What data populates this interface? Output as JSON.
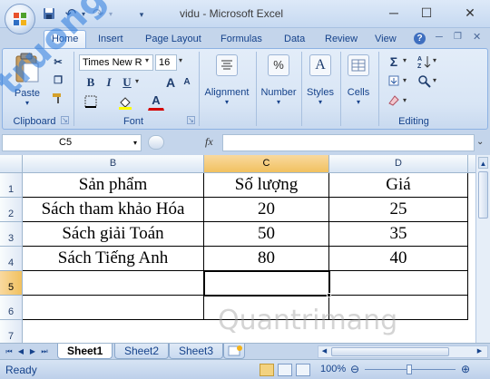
{
  "window": {
    "title": "vidu - Microsoft Excel",
    "minimize_glyph": "─",
    "maximize_glyph": "☐",
    "close_glyph": "✕"
  },
  "quick_access": [
    "save-icon",
    "undo-icon",
    "redo-icon",
    "customize-icon"
  ],
  "tabs": [
    {
      "label": "Home",
      "active": true
    },
    {
      "label": "Insert"
    },
    {
      "label": "Page Layout"
    },
    {
      "label": "Formulas"
    },
    {
      "label": "Data"
    },
    {
      "label": "Review"
    },
    {
      "label": "View"
    }
  ],
  "ribbon": {
    "clipboard": {
      "paste_label": "Paste",
      "group_label": "Clipboard"
    },
    "font": {
      "family": "Times New R",
      "size": "16",
      "bold": "B",
      "italic": "I",
      "underline": "U",
      "group_label": "Font",
      "grow": "A",
      "shrink": "A",
      "font_color": "A"
    },
    "alignment": {
      "label": "Alignment"
    },
    "number": {
      "label": "Number",
      "symbol": "%"
    },
    "styles": {
      "label": "Styles"
    },
    "cells": {
      "label": "Cells"
    },
    "editing": {
      "group_label": "Editing",
      "sigma": "Σ"
    }
  },
  "formula_bar": {
    "name_box": "C5",
    "fx": "fx",
    "formula": ""
  },
  "grid": {
    "columns": [
      {
        "label": "B",
        "selected": false
      },
      {
        "label": "C",
        "selected": true
      },
      {
        "label": "D",
        "selected": false
      }
    ],
    "rows": [
      "1",
      "2",
      "3",
      "4",
      "5",
      "6",
      "7"
    ],
    "selected_row": "5",
    "active_cell": "C5",
    "cells": [
      [
        "Sản phẩm",
        "Số lượng",
        "Giá"
      ],
      [
        "Sách tham khảo Hóa",
        "20",
        "25"
      ],
      [
        "Sách giải Toán",
        "50",
        "35"
      ],
      [
        "Sách Tiếng Anh",
        "80",
        "40"
      ],
      [
        "",
        "",
        ""
      ],
      [
        "",
        "",
        ""
      ]
    ]
  },
  "sheets": [
    {
      "label": "Sheet1",
      "active": true
    },
    {
      "label": "Sheet2"
    },
    {
      "label": "Sheet3"
    }
  ],
  "status": {
    "text": "Ready",
    "zoom": "100%",
    "zoom_minus": "⊖",
    "zoom_plus": "⊕"
  },
  "watermarks": {
    "left": "truongit.top",
    "bottom": "Quantrimang"
  }
}
